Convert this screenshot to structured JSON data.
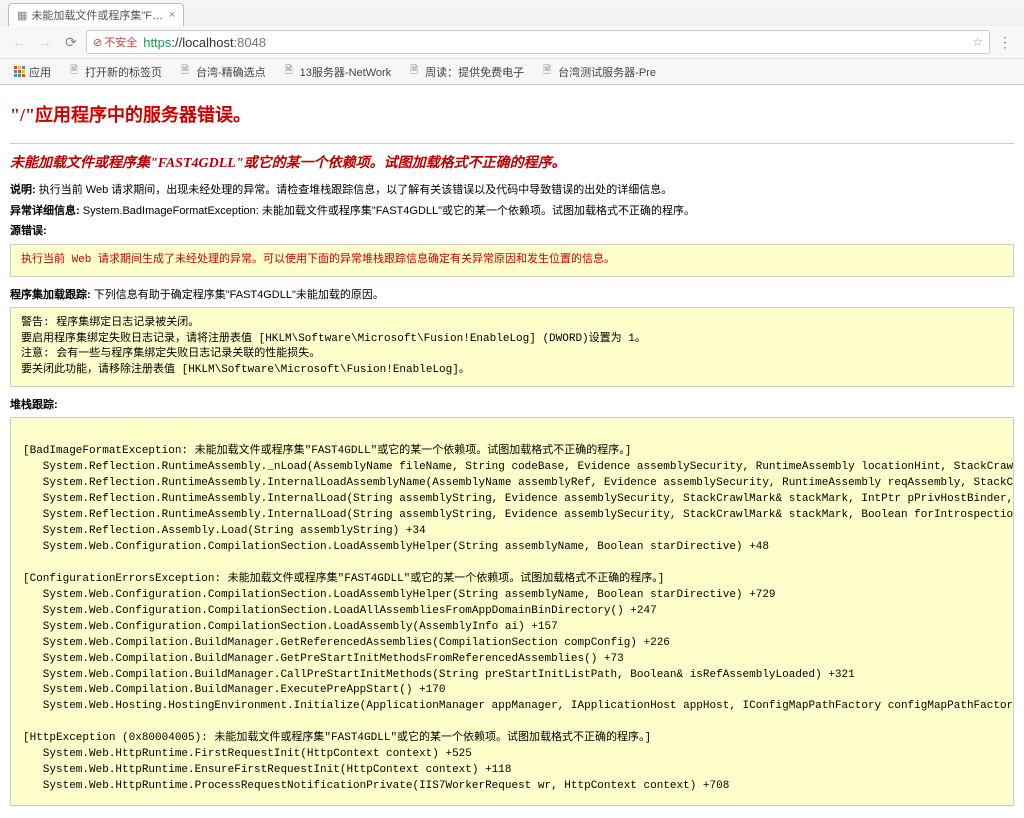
{
  "browser": {
    "tab_title": "未能加载文件或程序集\"F…",
    "security_label": "不安全",
    "url_proto": "https",
    "url_host": "://localhost",
    "url_port": ":8048",
    "bookmarks": {
      "apps": "应用",
      "new_tab": "打开新的标签页",
      "tw_picks": "台湾-精确选点",
      "server13": "13服务器-NetWork",
      "zhou": "周读：提供免费电子",
      "tw_test": "台湾测试服务器-Pre"
    }
  },
  "error": {
    "h1": "\"/\"应用程序中的服务器错误。",
    "h2": "未能加载文件或程序集\"FAST4GDLL\"或它的某一个依赖项。试图加载格式不正确的程序。",
    "desc_label": "说明: ",
    "desc_text": "执行当前 Web 请求期间，出现未经处理的异常。请检查堆栈跟踪信息，以了解有关该错误以及代码中导致错误的出处的详细信息。",
    "exc_label": "异常详细信息: ",
    "exc_text": "System.BadImageFormatException: 未能加载文件或程序集\"FAST4GDLL\"或它的某一个依赖项。试图加载格式不正确的程序。",
    "src_label": "源错误:",
    "src_code": "执行当前 Web 请求期间生成了未经处理的异常。可以使用下面的异常堆栈跟踪信息确定有关异常原因和发生位置的信息。",
    "asm_label": "程序集加载跟踪: ",
    "asm_text": "下列信息有助于确定程序集\"FAST4GDLL\"未能加载的原因。",
    "asm_code": "警告: 程序集绑定日志记录被关闭。\n要启用程序集绑定失败日志记录，请将注册表值 [HKLM\\Software\\Microsoft\\Fusion!EnableLog] (DWORD)设置为 1。\n注意: 会有一些与程序集绑定失败日志记录关联的性能损失。\n要关闭此功能，请移除注册表值 [HKLM\\Software\\Microsoft\\Fusion!EnableLog]。",
    "stack_label": "堆栈跟踪:",
    "stack_code": "\n[BadImageFormatException: 未能加载文件或程序集\"FAST4GDLL\"或它的某一个依赖项。试图加载格式不正确的程序。]\n   System.Reflection.RuntimeAssembly._nLoad(AssemblyName fileName, String codeBase, Evidence assemblySecurity, RuntimeAssembly locationHint, StackCrawlMark& stackMark, IntPtr pPrivHo\n   System.Reflection.RuntimeAssembly.InternalLoadAssemblyName(AssemblyName assemblyRef, Evidence assemblySecurity, RuntimeAssembly reqAssembly, StackCrawlMark& stackMark, IntPtr pPri\n   System.Reflection.RuntimeAssembly.InternalLoad(String assemblyString, Evidence assemblySecurity, StackCrawlMark& stackMark, IntPtr pPrivHostBinder, Boolean forIntrospection) +110\n   System.Reflection.RuntimeAssembly.InternalLoad(String assemblyString, Evidence assemblySecurity, StackCrawlMark& stackMark, Boolean forIntrospection) +22\n   System.Reflection.Assembly.Load(String assemblyString) +34\n   System.Web.Configuration.CompilationSection.LoadAssemblyHelper(String assemblyName, Boolean starDirective) +48\n\n[ConfigurationErrorsException: 未能加载文件或程序集\"FAST4GDLL\"或它的某一个依赖项。试图加载格式不正确的程序。]\n   System.Web.Configuration.CompilationSection.LoadAssemblyHelper(String assemblyName, Boolean starDirective) +729\n   System.Web.Configuration.CompilationSection.LoadAllAssembliesFromAppDomainBinDirectory() +247\n   System.Web.Configuration.CompilationSection.LoadAssembly(AssemblyInfo ai) +157\n   System.Web.Compilation.BuildManager.GetReferencedAssemblies(CompilationSection compConfig) +226\n   System.Web.Compilation.BuildManager.GetPreStartInitMethodsFromReferencedAssemblies() +73\n   System.Web.Compilation.BuildManager.CallPreStartInitMethods(String preStartInitListPath, Boolean& isRefAssemblyLoaded) +321\n   System.Web.Compilation.BuildManager.ExecutePreAppStart() +170\n   System.Web.Hosting.HostingEnvironment.Initialize(ApplicationManager appManager, IApplicationHost appHost, IConfigMapPathFactory configMapPathFactory, HostingEnvironmentParameters\n\n[HttpException (0x80004005): 未能加载文件或程序集\"FAST4GDLL\"或它的某一个依赖项。试图加载格式不正确的程序。]\n   System.Web.HttpRuntime.FirstRequestInit(HttpContext context) +525\n   System.Web.HttpRuntime.EnsureFirstRequestInit(HttpContext context) +118\n   System.Web.HttpRuntime.ProcessRequestNotificationPrivate(IIS7WorkerRequest wr, HttpContext context) +708"
  }
}
